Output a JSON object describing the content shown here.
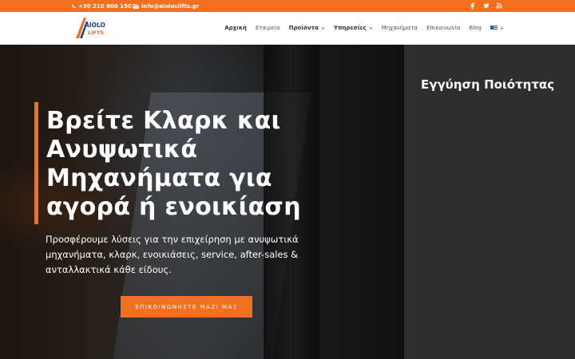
{
  "topbar": {
    "phone": "+30 210 800 1507",
    "email": "info@aioloslifts.gr",
    "social": [
      "facebook-icon",
      "twitter-icon",
      "rss-icon"
    ],
    "color": "#f37021"
  },
  "header": {
    "logo_text_top": "AIOLOS",
    "logo_text_bottom": "LIFTS",
    "nav": [
      {
        "label": "Αρχική"
      },
      {
        "label": "Εταιρεία"
      },
      {
        "label": "Προϊόντα"
      },
      {
        "label": "Υπηρεσίες"
      },
      {
        "label": "Μηχανήματα"
      },
      {
        "label": "Επικοινωνία"
      },
      {
        "label": "Blog"
      }
    ]
  },
  "hero": {
    "headline": "Βρείτε Κλαρκ και Ανυψωτικά Μηχανήματα για αγορά ή ενοικίαση",
    "subtext": "Προσφέρουμε λύσεις για την επιχείρηση με ανυψωτικά μηχανήματα, κλαρκ, ενοικιάσεις, service, after-sales & ανταλλακτικά κάθε είδους.",
    "cta_label": "ΕΠΙΚΟΙΝΩΝΗΣΤΕ ΜΑΖΙ ΜΑΣ"
  },
  "sidebar": {
    "title": "Εγγύηση Ποιότητας"
  }
}
